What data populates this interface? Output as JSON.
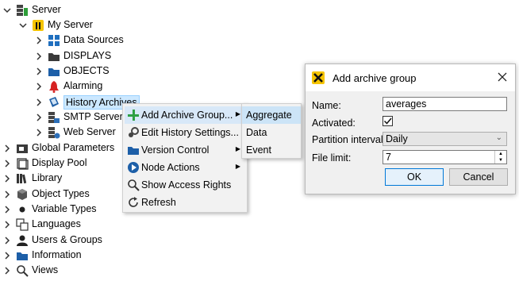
{
  "tree": {
    "items": [
      {
        "label": "Server",
        "icon": "server-icon",
        "expanded": true
      },
      {
        "label": "My Server",
        "icon": "my-server-icon",
        "expanded": true
      },
      {
        "label": "Data Sources",
        "icon": "data-sources-icon"
      },
      {
        "label": "DISPLAYS",
        "icon": "folder-icon"
      },
      {
        "label": "OBJECTS",
        "icon": "folder-icon"
      },
      {
        "label": "Alarming",
        "icon": "bell-icon"
      },
      {
        "label": "History Archives",
        "icon": "history-archives-icon",
        "selected": true
      },
      {
        "label": "SMTP Server",
        "icon": "smtp-server-icon"
      },
      {
        "label": "Web Server",
        "icon": "web-server-icon"
      },
      {
        "label": "Global Parameters",
        "icon": "global-parameters-icon"
      },
      {
        "label": "Display Pool",
        "icon": "display-pool-icon"
      },
      {
        "label": "Library",
        "icon": "library-icon"
      },
      {
        "label": "Object Types",
        "icon": "cube-icon"
      },
      {
        "label": "Variable Types",
        "icon": "bullet-icon"
      },
      {
        "label": "Languages",
        "icon": "languages-icon"
      },
      {
        "label": "Users & Groups",
        "icon": "user-icon"
      },
      {
        "label": "Information",
        "icon": "folder-icon"
      },
      {
        "label": "Views",
        "icon": "search-icon"
      }
    ]
  },
  "context_menu": {
    "items": [
      {
        "label": "Add Archive Group...",
        "icon": "plus-icon",
        "has_submenu": true,
        "active": true
      },
      {
        "label": "Edit History Settings...",
        "icon": "gears-icon"
      },
      {
        "label": "Version Control",
        "icon": "folder-icon",
        "has_submenu": true
      },
      {
        "label": "Node Actions",
        "icon": "play-icon",
        "has_submenu": true
      },
      {
        "label": "Show Access Rights",
        "icon": "search-icon"
      },
      {
        "label": "Refresh",
        "icon": "refresh-icon"
      }
    ]
  },
  "submenu": {
    "items": [
      {
        "label": "Aggregate",
        "active": true
      },
      {
        "label": "Data"
      },
      {
        "label": "Event"
      }
    ]
  },
  "dialog": {
    "title": "Add archive group",
    "name_label": "Name:",
    "name_value": "averages",
    "activated_label": "Activated:",
    "activated_checked": true,
    "partition_label": "Partition interval:",
    "partition_value": "Daily",
    "file_limit_label": "File limit:",
    "file_limit_value": "7",
    "ok_label": "OK",
    "cancel_label": "Cancel"
  }
}
